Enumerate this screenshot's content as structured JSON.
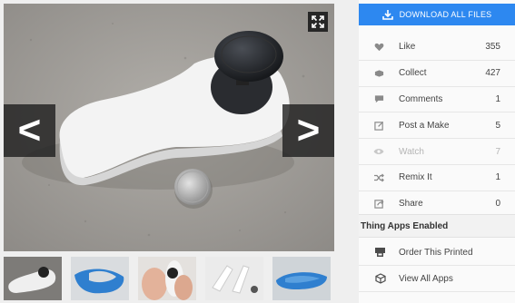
{
  "gallery": {
    "prev_label": "<",
    "next_label": ">",
    "thumbnails": [
      "thumb-1",
      "thumb-2",
      "thumb-3",
      "thumb-4",
      "thumb-5",
      "thumb-6"
    ]
  },
  "panel": {
    "download_label": "DOWNLOAD ALL FILES",
    "stats": [
      {
        "label": "Like",
        "count": "355",
        "icon": "heart-icon"
      },
      {
        "label": "Collect",
        "count": "427",
        "icon": "collect-icon"
      },
      {
        "label": "Comments",
        "count": "1",
        "icon": "comment-icon"
      },
      {
        "label": "Post a Make",
        "count": "5",
        "icon": "post-make-icon"
      },
      {
        "label": "Watch",
        "count": "7",
        "icon": "eye-icon"
      },
      {
        "label": "Remix It",
        "count": "1",
        "icon": "remix-icon"
      },
      {
        "label": "Share",
        "count": "0",
        "icon": "share-icon"
      }
    ],
    "apps_title": "Thing Apps Enabled",
    "apps": [
      {
        "label": "Order This Printed",
        "icon": "printer-icon"
      },
      {
        "label": "View All Apps",
        "icon": "cube-icon"
      }
    ]
  },
  "colors": {
    "accent": "#2d88f0",
    "panel_bg": "#fafafa",
    "nav_bg": "#1e1e1e"
  }
}
